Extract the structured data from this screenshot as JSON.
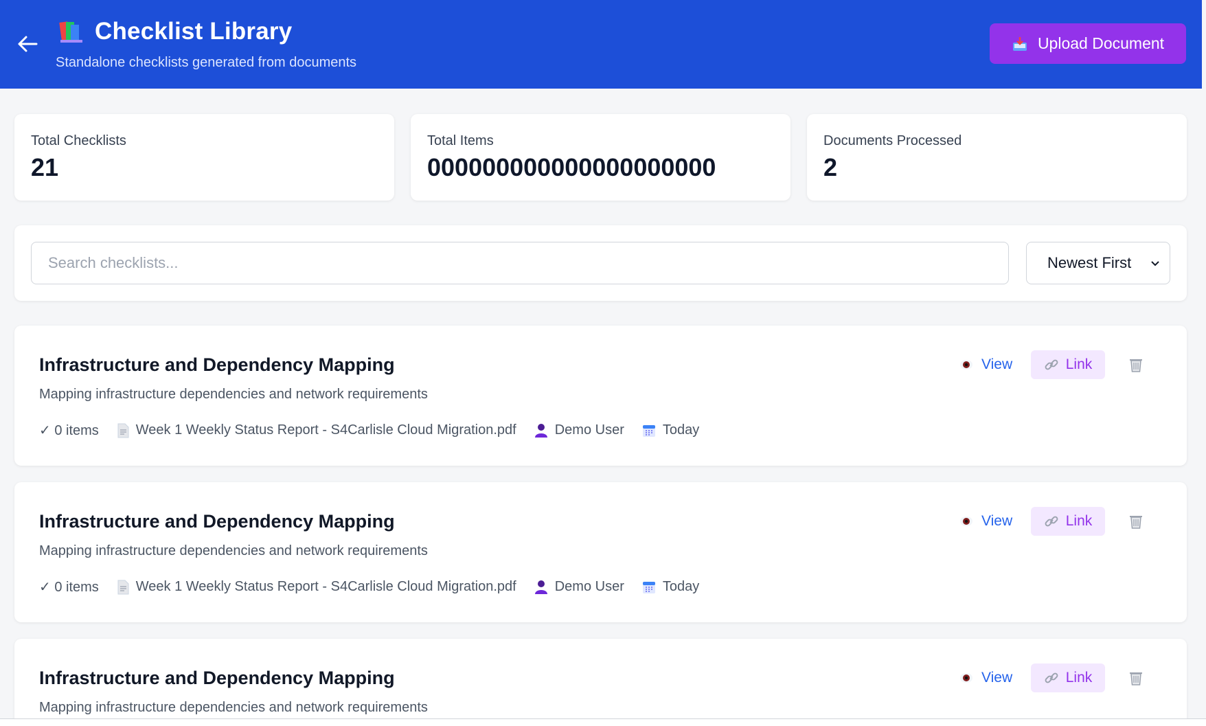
{
  "header": {
    "title": "Checklist Library",
    "subtitle": "Standalone checklists generated from documents",
    "upload_label": "Upload Document",
    "colors": {
      "background": "#1d4fd8",
      "upload_button": "#9333ea"
    }
  },
  "stats": [
    {
      "label": "Total Checklists",
      "value": "21"
    },
    {
      "label": "Total Items",
      "value": "000000000000000000000"
    },
    {
      "label": "Documents Processed",
      "value": "2"
    }
  ],
  "filters": {
    "search_placeholder": "Search checklists...",
    "search_value": "",
    "sort_selected": "Newest First"
  },
  "checklists": [
    {
      "title": "Infrastructure and Dependency Mapping",
      "description": "Mapping infrastructure dependencies and network requirements",
      "items": "✓ 0 items",
      "document": "Week 1 Weekly Status Report - S4Carlisle Cloud Migration.pdf",
      "user": "Demo User",
      "date": "Today",
      "view_label": "View",
      "link_label": "Link"
    },
    {
      "title": "Infrastructure and Dependency Mapping",
      "description": "Mapping infrastructure dependencies and network requirements",
      "items": "✓ 0 items",
      "document": "Week 1 Weekly Status Report - S4Carlisle Cloud Migration.pdf",
      "user": "Demo User",
      "date": "Today",
      "view_label": "View",
      "link_label": "Link"
    },
    {
      "title": "Infrastructure and Dependency Mapping",
      "description": "Mapping infrastructure dependencies and network requirements",
      "view_label": "View",
      "link_label": "Link"
    }
  ],
  "icons": [
    "arrow-left-icon",
    "books-icon",
    "inbox-tray-icon",
    "document-icon",
    "user-icon",
    "calendar-icon",
    "eye-icon",
    "link-icon",
    "trash-icon",
    "chevron-down-icon"
  ]
}
